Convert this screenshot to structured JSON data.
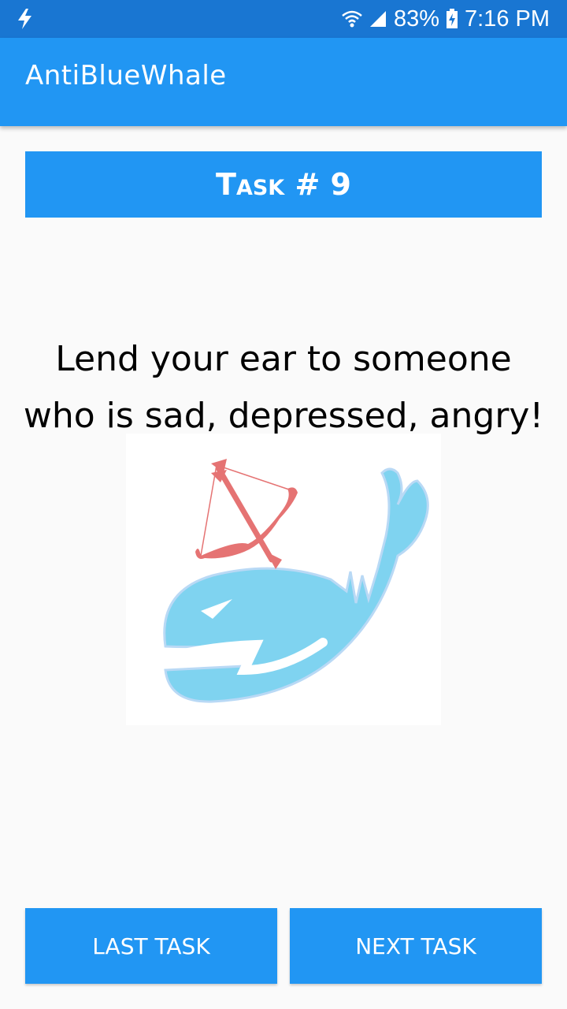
{
  "status_bar": {
    "battery": "83%",
    "time": "7:16 PM",
    "icons": [
      "charging-bolt-icon",
      "wifi-icon",
      "signal-icon",
      "battery-icon"
    ]
  },
  "app_bar": {
    "title": "AntiBlueWhale"
  },
  "task": {
    "header": "Task # 9",
    "text": "Lend your ear to someone who is sad, depressed, angry!",
    "image_icon": "whale-with-bow-arrow-illustration"
  },
  "buttons": {
    "last_label": "LAST TASK",
    "next_label": "NEXT TASK"
  },
  "colors": {
    "status_bar": "#1976d2",
    "primary": "#2196f3",
    "whale": "#7fd3f0",
    "bow": "#e57373"
  }
}
